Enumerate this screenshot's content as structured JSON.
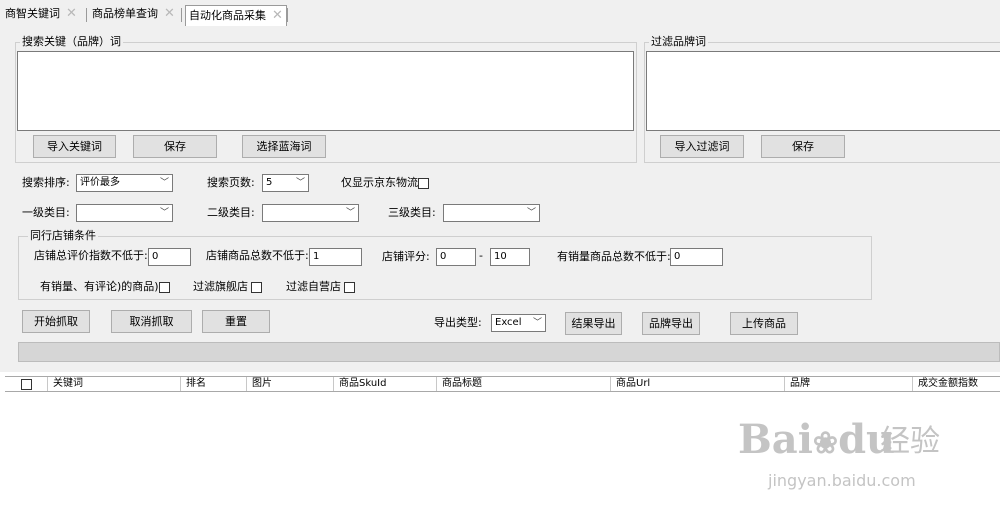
{
  "tabs": [
    {
      "label": "商智关键词",
      "active": false
    },
    {
      "label": "商品榜单查询",
      "active": false
    },
    {
      "label": "自动化商品采集",
      "active": true
    }
  ],
  "keyword_group": {
    "title": "搜索关键（品牌）词",
    "buttons": {
      "import": "导入关键词",
      "save": "保存",
      "blue_ocean": "选择蓝海词"
    }
  },
  "filter_group": {
    "title": "过滤品牌词",
    "buttons": {
      "import": "导入过滤词",
      "save": "保存"
    }
  },
  "search_options": {
    "sort_label": "搜索排序:",
    "sort_value": "评价最多",
    "pages_label": "搜索页数:",
    "pages_value": "5",
    "jd_logistics_label": "仅显示京东物流",
    "jd_logistics_checked": false
  },
  "categories": {
    "level1_label": "一级类目:",
    "level1_value": "",
    "level2_label": "二级类目:",
    "level2_value": "",
    "level3_label": "三级类目:",
    "level3_value": ""
  },
  "shop_conditions": {
    "title": "同行店铺条件",
    "review_index_label": "店铺总评价指数不低于:",
    "review_index_value": "0",
    "product_total_label": "店铺商品总数不低于:",
    "product_total_value": "1",
    "score_label": "店铺评分:",
    "score_min": "0",
    "score_dash": "-",
    "score_max": "10",
    "sales_total_label": "有销量商品总数不低于:",
    "sales_total_value": "0",
    "has_sales_label": "有销量、有评论)的商品)",
    "flagship_label": "过滤旗舰店",
    "self_operated_label": "过滤自营店"
  },
  "actions": {
    "start": "开始抓取",
    "cancel": "取消抓取",
    "reset": "重置",
    "export_type_label": "导出类型:",
    "export_type_value": "Excel",
    "export_results": "结果导出",
    "export_brands": "品牌导出",
    "upload": "上传商品"
  },
  "progress": 0,
  "table": {
    "columns": [
      "关键词",
      "排名",
      "图片",
      "商品SkuId",
      "商品标题",
      "商品Url",
      "品牌",
      "成交金额指数"
    ],
    "rows": []
  },
  "watermark": {
    "brand": "Bai",
    "brand2": "du",
    "cn": "经验",
    "url": "jingyan.baidu.com"
  },
  "colors": {
    "background": "#f0f0f0",
    "button": "#e1e1e1",
    "border": "#adadad",
    "watermark": "#c4c4c4"
  }
}
